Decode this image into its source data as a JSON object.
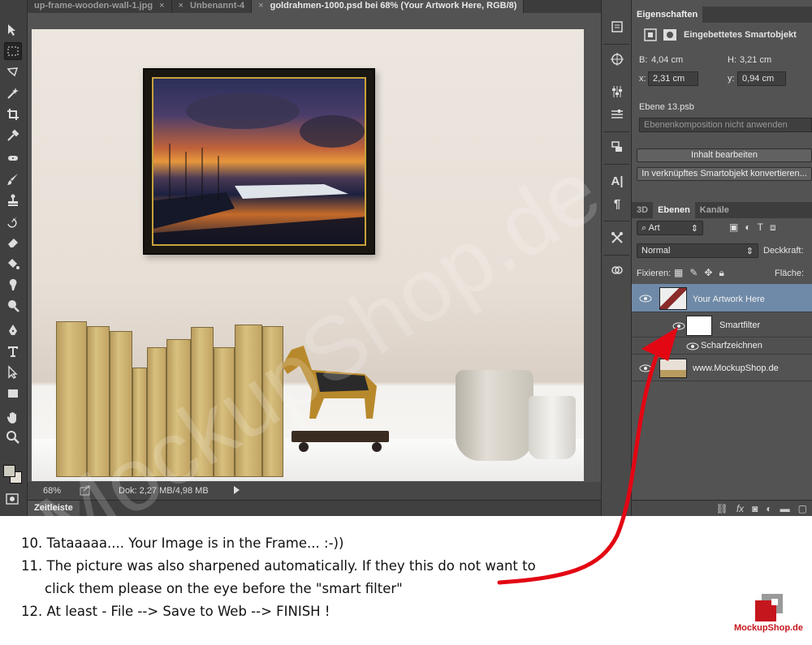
{
  "tabs": [
    {
      "label": "up-frame-wooden-wall-1.jpg",
      "close": "×"
    },
    {
      "label": "Unbenannt-4",
      "close": "×"
    },
    {
      "label": "goldrahmen-1000.psd bei 68% (Your Artwork Here, RGB/8)",
      "close": "×"
    }
  ],
  "status": {
    "zoom": "68%",
    "doc": "Dok: 2,27 MB/4,98 MB"
  },
  "timeline": {
    "label": "Zeitleiste"
  },
  "properties": {
    "tab": "Eigenschaften",
    "type": "Eingebettetes Smartobjekt",
    "b_label": "B:",
    "b_value": "4,04 cm",
    "h_label": "H:",
    "h_value": "3,21 cm",
    "x_label": "x:",
    "x_value": "2,31 cm",
    "y_label": "y:",
    "y_value": "0,94 cm",
    "file": "Ebene 13.psb",
    "comp_placeholder": "Ebenenkomposition nicht anwenden",
    "edit_button": "Inhalt bearbeiten",
    "convert_button": "In verknüpftes Smartobjekt konvertieren..."
  },
  "layers_panel": {
    "tabs": [
      "3D",
      "Ebenen",
      "Kanäle"
    ],
    "active_tab": "Ebenen",
    "filter": "Art",
    "blend_mode": "Normal",
    "opacity_label": "Deckkraft:",
    "lock_label": "Fixieren:",
    "fill_label": "Fläche:",
    "layers": [
      {
        "name": "Your Artwork Here"
      },
      {
        "name": "Smartfilter"
      },
      {
        "name": "Scharfzeichnen"
      },
      {
        "name": "www.MockupShop.de"
      }
    ]
  },
  "instructions": [
    "10. Tataaaaa.... Your Image is in the Frame... :-))",
    "11. The picture was also sharpened automatically. If they this do not want to",
    "click them please on the eye before the \"smart filter\"",
    "12. At least - File --> Save to Web --> FINISH !"
  ],
  "brand": {
    "logo_text": "MockupShop.de",
    "watermark": "MockupShop.de",
    "color": "#c5161d"
  }
}
